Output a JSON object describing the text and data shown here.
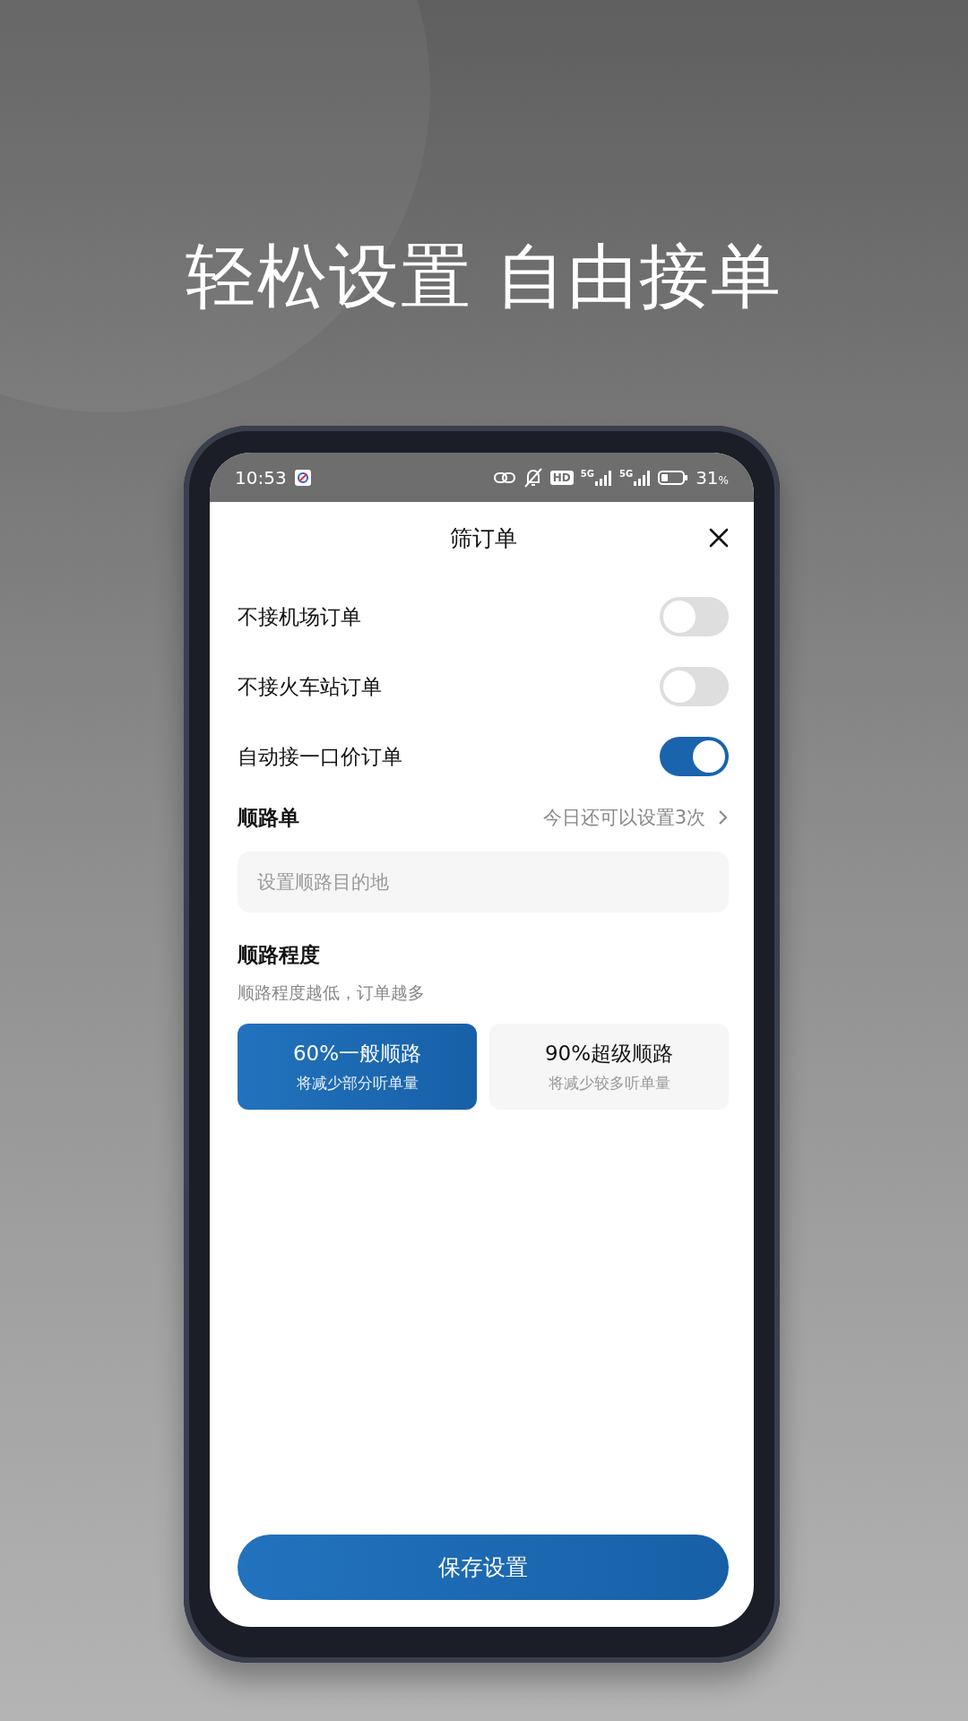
{
  "headline": "轻松设置 自由接单",
  "status_bar": {
    "time": "10:53",
    "hd": "HD",
    "signals": [
      {
        "label": "5G"
      },
      {
        "label": "5G"
      }
    ],
    "battery": "31",
    "battery_unit": "%"
  },
  "sheet": {
    "title": "筛订单"
  },
  "toggles": [
    {
      "label": "不接机场订单",
      "on": false
    },
    {
      "label": "不接火车站订单",
      "on": false
    },
    {
      "label": "自动接一口价订单",
      "on": true
    }
  ],
  "route": {
    "label": "顺路单",
    "remaining": "今日还可以设置3次",
    "placeholder": "设置顺路目的地"
  },
  "degree": {
    "title": "顺路程度",
    "hint": "顺路程度越低，订单越多",
    "options": [
      {
        "title": "60%一般顺路",
        "note": "将减少部分听单量",
        "selected": true
      },
      {
        "title": "90%超级顺路",
        "note": "将减少较多听单量",
        "selected": false
      }
    ]
  },
  "save_button": "保存设置"
}
